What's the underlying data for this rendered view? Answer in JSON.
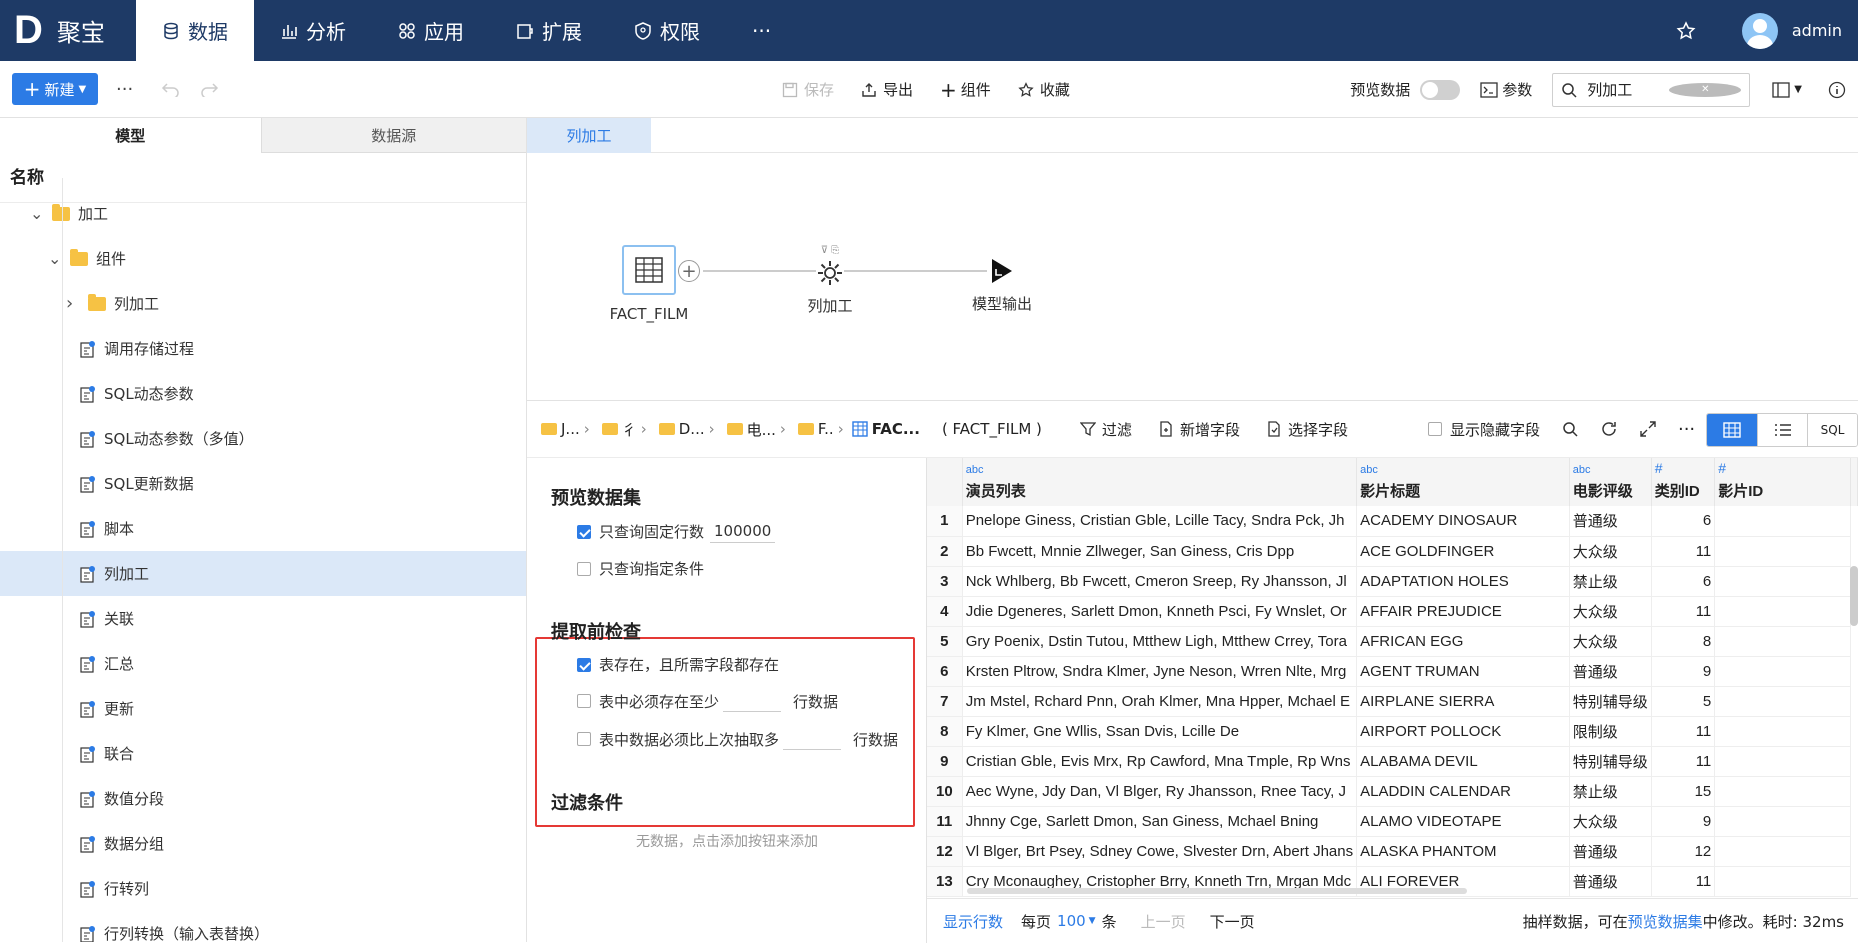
{
  "app": {
    "logo_letter": "D",
    "logo_text": "聚宝"
  },
  "nav": [
    {
      "label": "数据",
      "active": true
    },
    {
      "label": "分析"
    },
    {
      "label": "应用"
    },
    {
      "label": "扩展"
    },
    {
      "label": "权限"
    }
  ],
  "nav_more": "···",
  "user": {
    "name": "admin"
  },
  "toolbar": {
    "new_label": "新建",
    "more": "···",
    "save": "保存",
    "export": "导出",
    "component": "组件",
    "favorite": "收藏",
    "preview_data": "预览数据",
    "params": "参数",
    "search_value": "列加工"
  },
  "left_tabs": [
    "模型",
    "数据源"
  ],
  "tree_header": "名称",
  "tree": [
    {
      "label": "加工",
      "type": "folder",
      "open": true,
      "indent": 0
    },
    {
      "label": "组件",
      "type": "folder",
      "open": true,
      "indent": 1
    },
    {
      "label": "列加工",
      "type": "folder",
      "open": false,
      "indent": 2
    },
    {
      "label": "调用存储过程",
      "type": "comp",
      "indent": 2
    },
    {
      "label": "SQL动态参数",
      "type": "comp",
      "indent": 2
    },
    {
      "label": "SQL动态参数（多值）",
      "type": "comp",
      "indent": 2
    },
    {
      "label": "SQL更新数据",
      "type": "comp",
      "indent": 2
    },
    {
      "label": "脚本",
      "type": "comp",
      "indent": 2
    },
    {
      "label": "列加工",
      "type": "comp",
      "indent": 2,
      "selected": true
    },
    {
      "label": "关联",
      "type": "comp",
      "indent": 2
    },
    {
      "label": "汇总",
      "type": "comp",
      "indent": 2
    },
    {
      "label": "更新",
      "type": "comp",
      "indent": 2
    },
    {
      "label": "联合",
      "type": "comp",
      "indent": 2
    },
    {
      "label": "数值分段",
      "type": "comp",
      "indent": 2
    },
    {
      "label": "数据分组",
      "type": "comp",
      "indent": 2
    },
    {
      "label": "行转列",
      "type": "comp",
      "indent": 2
    },
    {
      "label": "行列转换（输入表替换）",
      "type": "comp",
      "indent": 2
    }
  ],
  "canvas": {
    "tab": "列加工",
    "nodes": {
      "source": "FACT_FILM",
      "process": "列加工",
      "output": "模型输出"
    }
  },
  "breadcrumb": {
    "items": [
      "J...",
      "彳",
      "D...",
      "电...",
      "F.."
    ],
    "current": "FAC...",
    "table": "( FACT_FILM )"
  },
  "bottom_actions": {
    "filter": "过滤",
    "add_field": "新增字段",
    "select_field": "选择字段",
    "show_hidden": "显示隐藏字段",
    "sql": "SQL"
  },
  "config": {
    "preview_title": "预览数据集",
    "fixed_rows_label": "只查询固定行数",
    "fixed_rows_value": "100000",
    "cond_label": "只查询指定条件",
    "check_title": "提取前检查",
    "check1": "表存在，且所需字段都存在",
    "check2": "表中必须存在至少",
    "check3": "表中数据必须比上次抽取多",
    "rows_suffix": "行数据",
    "filter_title": "过滤条件",
    "filter_empty": "无数据，点击添加按钮来添加"
  },
  "grid": {
    "columns": [
      {
        "type": "abc",
        "name": "演员列表"
      },
      {
        "type": "abc",
        "name": "影片标题"
      },
      {
        "type": "abc",
        "name": "电影评级"
      },
      {
        "type": "#",
        "name": "类别ID"
      },
      {
        "type": "#",
        "name": "影片ID"
      }
    ],
    "rows": [
      [
        "1",
        "Pnelope Giness, Cristian Gble, Lcille Tacy, Sndra Pck, Jh",
        "ACADEMY DINOSAUR",
        "普通级",
        "6"
      ],
      [
        "2",
        "Bb Fwcett, Mnnie Zllweger, San Giness, Cris Dpp",
        "ACE GOLDFINGER",
        "大众级",
        "11"
      ],
      [
        "3",
        "Nck Whlberg, Bb Fwcett, Cmeron Sreep, Ry Jhansson, Jl",
        "ADAPTATION HOLES",
        "禁止级",
        "6"
      ],
      [
        "4",
        "Jdie Dgeneres, Sarlett Dmon, Knneth Psci, Fy Wnslet, Or",
        "AFFAIR PREJUDICE",
        "大众级",
        "11"
      ],
      [
        "5",
        "Gry Poenix, Dstin Tutou, Mtthew Ligh, Mtthew Crrey, Tora",
        "AFRICAN EGG",
        "大众级",
        "8"
      ],
      [
        "6",
        "Krsten Pltrow, Sndra Klmer, Jyne Neson, Wrren Nlte, Mrg",
        "AGENT TRUMAN",
        "普通级",
        "9"
      ],
      [
        "7",
        "Jm Mstel, Rchard Pnn, Orah Klmer, Mna Hpper, Mchael E",
        "AIRPLANE SIERRA",
        "特别辅导级",
        "5"
      ],
      [
        "8",
        "Fy Klmer, Gne Wllis, Ssan Dvis, Lcille De",
        "AIRPORT POLLOCK",
        "限制级",
        "11"
      ],
      [
        "9",
        "Cristian Gble, Evis Mrx, Rp Cawford, Mna Tmple, Rp Wns",
        "ALABAMA DEVIL",
        "特别辅导级",
        "11"
      ],
      [
        "10",
        "Aec Wyne, Jdy Dan, Vl Blger, Ry Jhansson, Rnee Tacy, J",
        "ALADDIN CALENDAR",
        "禁止级",
        "15"
      ],
      [
        "11",
        "Jhnny Cge, Sarlett Dmon, San Giness, Mchael Bning",
        "ALAMO VIDEOTAPE",
        "大众级",
        "9"
      ],
      [
        "12",
        "Vl Blger, Brt Psey, Sdney Cowe, Slvester Drn, Abert Jhans",
        "ALASKA PHANTOM",
        "普通级",
        "12"
      ],
      [
        "13",
        "Cry Mconaughey, Cristopher Brry, Knneth Trn, Mrgan Mdc",
        "ALI FOREVER",
        "普通级",
        "11"
      ]
    ]
  },
  "pager": {
    "show_rows": "显示行数",
    "per_page": "每页",
    "size": "100",
    "unit": "条",
    "prev": "上一页",
    "next": "下一页",
    "note_pre": "抽样数据，可在",
    "note_link": "预览数据集",
    "note_post": "中修改。耗时: 32ms"
  }
}
